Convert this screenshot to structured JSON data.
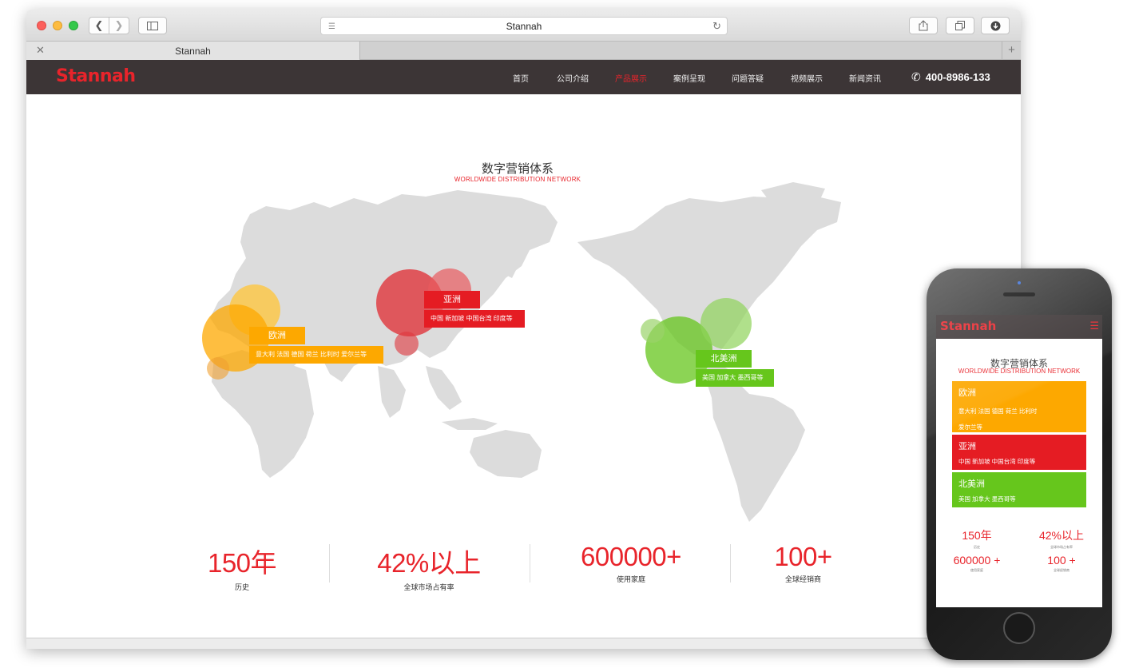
{
  "browser": {
    "address": "Stannah",
    "tab_title": "Stannah",
    "tab_add": "+"
  },
  "site": {
    "logo": "Stannah",
    "nav": [
      "首页",
      "公司介绍",
      "产品展示",
      "案例呈现",
      "问题答疑",
      "视频展示",
      "新闻资讯"
    ],
    "active_nav": "产品展示",
    "phone": "400-8986-133"
  },
  "section": {
    "title": "数字营销体系",
    "subtitle": "WORLDWIDE DISTRIBUTION NETWORK"
  },
  "regions": [
    {
      "name": "欧洲",
      "countries": "意大利  法国  德国  荷兰  比利时  爱尔兰等",
      "color": "#fda800"
    },
    {
      "name": "亚洲",
      "countries": "中国  新加坡  中国台湾  印度等",
      "color": "#e51c23"
    },
    {
      "name": "北美洲",
      "countries": "美国  加拿大  墨西哥等",
      "color": "#66c61c"
    }
  ],
  "stats": [
    {
      "value": "150年",
      "label": "历史"
    },
    {
      "value": "42%以上",
      "label": "全球市场占有率"
    },
    {
      "value": "600000+",
      "label": "使用家庭"
    },
    {
      "value": "100+",
      "label": "全球经销商"
    }
  ],
  "mobile": {
    "logo": "Stannah",
    "title": "数字营销体系",
    "subtitle": "WORLDWIDE DISTRIBUTION NETWORK",
    "cards": [
      {
        "name": "欧洲",
        "countries_line1": "意大利  法国  德国  荷兰  比利时",
        "countries_line2": "爱尔兰等",
        "color": "#fda800"
      },
      {
        "name": "亚洲",
        "countries_line1": "中国  新加坡  中国台湾  印度等",
        "color": "#e51c23"
      },
      {
        "name": "北美洲",
        "countries_line1": "美国  加拿大  墨西哥等",
        "color": "#66c61c"
      }
    ],
    "stats": [
      {
        "value": "150年",
        "label": "历史"
      },
      {
        "value": "42%以上",
        "label": "全球市场占有率"
      },
      {
        "value": "600000 +",
        "label": "使用家庭"
      },
      {
        "value": "100 +",
        "label": "全球经销商"
      }
    ]
  },
  "icons": {
    "back": "chevron-left-icon",
    "forward": "chevron-right-icon",
    "sidebar": "sidebar-icon",
    "reader": "reader-lines-icon",
    "reload": "reload-icon",
    "share": "share-icon",
    "tabs": "tabs-overview-icon",
    "download": "download-icon",
    "phone": "phone-icon",
    "menu": "hamburger-menu-icon"
  }
}
